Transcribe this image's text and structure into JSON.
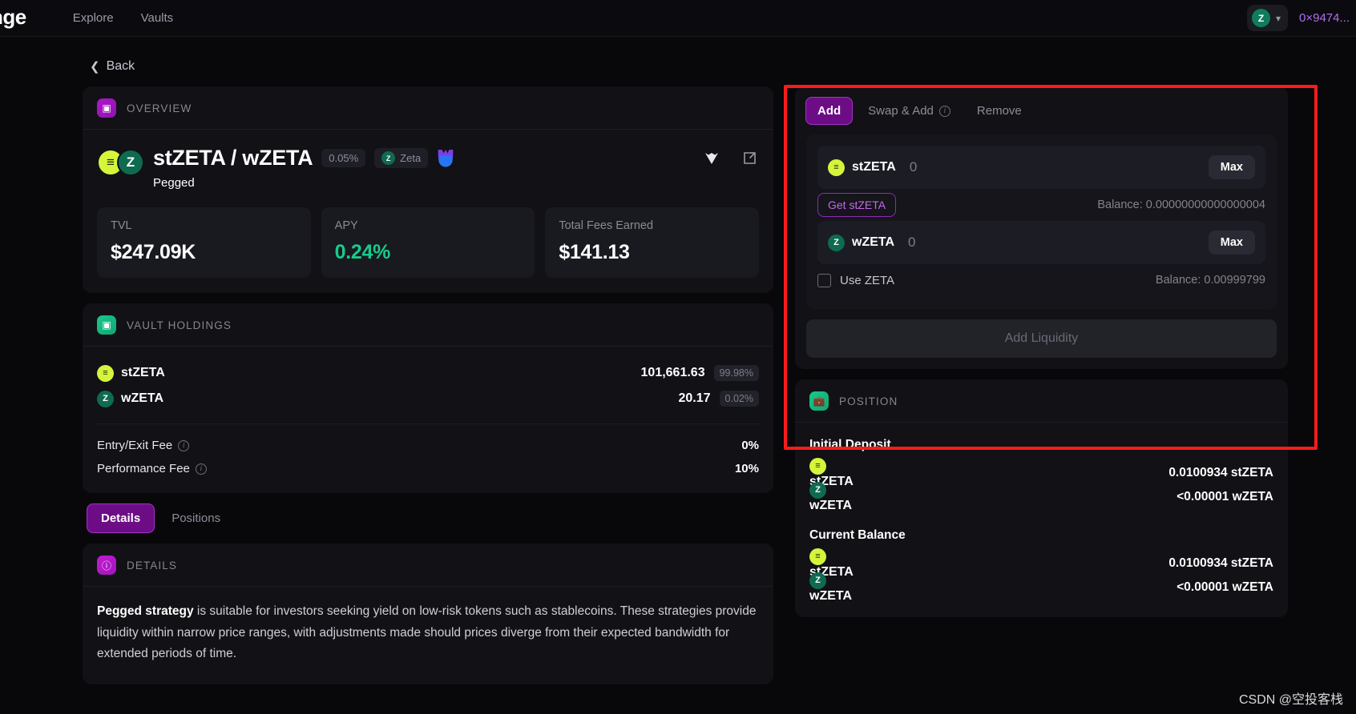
{
  "nav": {
    "brand": "nge",
    "links": [
      "Explore",
      "Vaults"
    ],
    "chain_symbol": "Z",
    "chain_icon": "zeta-chain-icon",
    "chevron": "⌄",
    "address": "0×9474..."
  },
  "back": {
    "label": "Back",
    "chevron": "‹"
  },
  "overview": {
    "section_title": "OVERVIEW",
    "section_icon": "overview-icon",
    "pair_title": "stZETA / wZETA",
    "fee_chip": "0.05%",
    "chain_chip": "Zeta",
    "chain_chip_symbol": "Z",
    "strategy": "Pegged",
    "stats": [
      {
        "label": "TVL",
        "value": "$247.09K",
        "accent": false
      },
      {
        "label": "APY",
        "value": "0.24%",
        "accent": true
      },
      {
        "label": "Total Fees Earned",
        "value": "$141.13",
        "accent": false
      }
    ]
  },
  "holdings": {
    "section_title": "VAULT HOLDINGS",
    "section_icon": "vault-holdings-icon",
    "rows": [
      {
        "token": "stZETA",
        "symbol": "≡",
        "amount": "101,661.63",
        "pct": "99.98%"
      },
      {
        "token": "wZETA",
        "symbol": "Z",
        "amount": "20.17",
        "pct": "0.02%"
      }
    ],
    "fees": [
      {
        "label": "Entry/Exit Fee",
        "value": "0%"
      },
      {
        "label": "Performance Fee",
        "value": "10%"
      }
    ]
  },
  "tabs": {
    "items": [
      "Details",
      "Positions"
    ],
    "active": "Details"
  },
  "details": {
    "section_title": "DETAILS",
    "section_icon": "details-info-icon",
    "lead": "Pegged strategy",
    "body": " is suitable for investors seeking yield on low-risk tokens such as stablecoins. These strategies provide liquidity within narrow price ranges, with adjustments made should prices diverge from their expected bandwidth for extended periods of time."
  },
  "action": {
    "tabs": [
      {
        "label": "Add",
        "active": true,
        "has_info": false
      },
      {
        "label": "Swap & Add",
        "active": false,
        "has_info": true
      },
      {
        "label": "Remove",
        "active": false,
        "has_info": false
      }
    ],
    "inputs": [
      {
        "token": "stZETA",
        "symbol": "≡",
        "amount": "0",
        "max_label": "Max",
        "sub_button": "Get stZETA",
        "balance": "Balance: 0.00000000000000004"
      },
      {
        "token": "wZETA",
        "symbol": "Z",
        "amount": "0",
        "max_label": "Max",
        "checkbox_label": "Use ZETA",
        "checkbox_checked": false,
        "balance": "Balance: 0.00999799"
      }
    ],
    "submit_label": "Add Liquidity"
  },
  "position": {
    "section_title": "POSITION",
    "section_icon": "position-bag-icon",
    "groups": [
      {
        "title": "Initial Deposit",
        "rows": [
          {
            "token": "stZETA",
            "symbol": "≡",
            "value": "0.0100934 stZETA"
          },
          {
            "token": "wZETA",
            "symbol": "Z",
            "value": "<0.00001 wZETA"
          }
        ]
      },
      {
        "title": "Current Balance",
        "rows": [
          {
            "token": "stZETA",
            "symbol": "≡",
            "value": "0.0100934 stZETA"
          },
          {
            "token": "wZETA",
            "symbol": "Z",
            "value": "<0.00001 wZETA"
          }
        ]
      }
    ]
  },
  "watermark": "CSDN @空投客栈",
  "colors": {
    "accent_purple": "#a432c4",
    "accent_green": "#15cc8a",
    "stzeta": "#d4f53c",
    "wzeta": "#0f6b4f",
    "address": "#b06cf0",
    "highlight_box": "#fc1b1b"
  }
}
